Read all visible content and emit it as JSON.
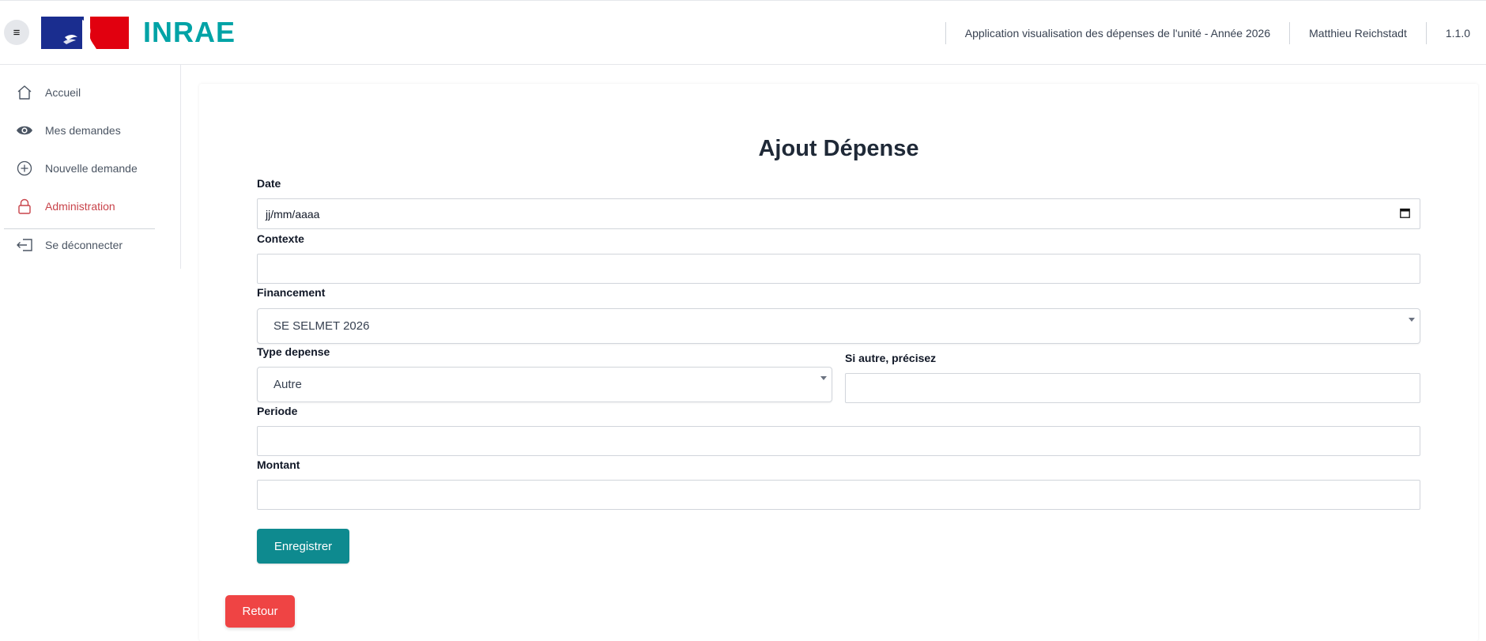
{
  "header": {
    "menu_icon": "hamburger-icon",
    "logo_text": "INRAE",
    "app_title": "Application visualisation des dépenses de l'unité - Année 2026",
    "user_name": "Matthieu Reichstadt",
    "version": "1.1.0"
  },
  "sidebar": {
    "items": [
      {
        "label": "Accueil",
        "icon": "home-icon"
      },
      {
        "label": "Mes demandes",
        "icon": "eye-icon"
      },
      {
        "label": "Nouvelle demande",
        "icon": "plus-circle-icon"
      },
      {
        "label": "Administration",
        "icon": "lock-icon"
      },
      {
        "label": "Se déconnecter",
        "icon": "logout-icon"
      }
    ],
    "accent_color": "#c8434a"
  },
  "form": {
    "title": "Ajout Dépense",
    "date": {
      "label": "Date",
      "placeholder": "jj/mm/aaaa"
    },
    "contexte": {
      "label": "Contexte",
      "value": ""
    },
    "financement": {
      "label": "Financement",
      "value": "SE SELMET 2026"
    },
    "type_depense": {
      "label": "Type depense",
      "value": "Autre"
    },
    "si_autre": {
      "label": "Si autre, précisez",
      "value": ""
    },
    "periode": {
      "label": "Periode",
      "value": ""
    },
    "montant": {
      "label": "Montant",
      "value": ""
    },
    "save_label": "Enregistrer",
    "back_label": "Retour"
  },
  "colors": {
    "primary": "#0e8a8f",
    "danger": "#ef4444",
    "brand": "#00a3a6"
  }
}
